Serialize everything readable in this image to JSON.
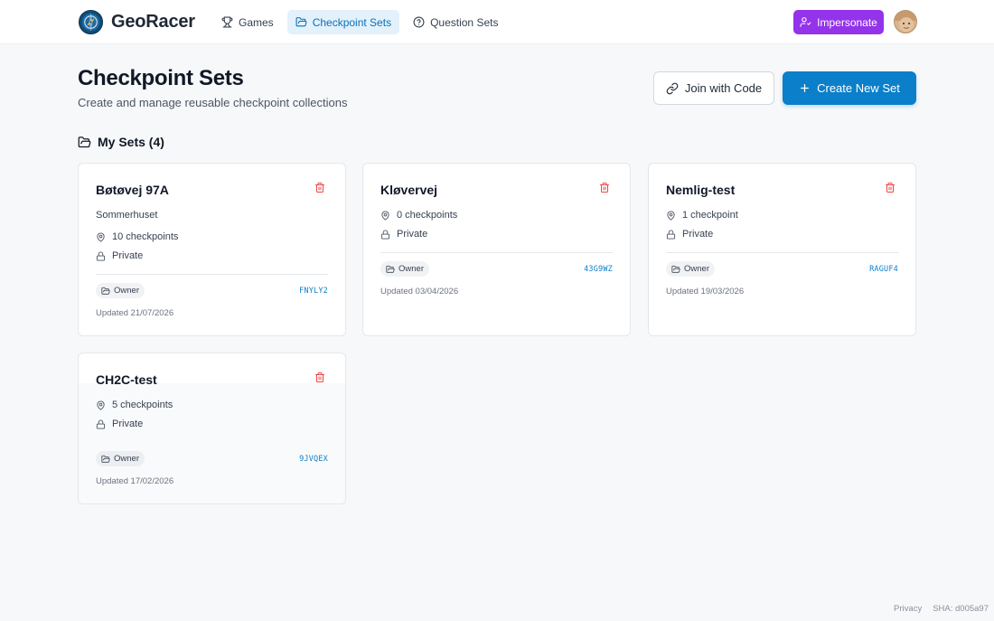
{
  "app": {
    "name": "GeoRacer"
  },
  "nav": {
    "games": "Games",
    "checkpoint_sets": "Checkpoint Sets",
    "question_sets": "Question Sets"
  },
  "header": {
    "impersonate": "Impersonate"
  },
  "page": {
    "title": "Checkpoint Sets",
    "subtitle": "Create and manage reusable checkpoint collections",
    "join_label": "Join with Code",
    "create_label": "Create New Set",
    "section_title": "My Sets (4)"
  },
  "cards": [
    {
      "name": "Bøtøvej 97A",
      "description": "Sommerhuset",
      "checkpoints": "10 checkpoints",
      "visibility": "Private",
      "role": "Owner",
      "code": "FNYLY2",
      "updated": "Updated 21/07/2026"
    },
    {
      "name": "Kløvervej",
      "checkpoints": "0 checkpoints",
      "visibility": "Private",
      "role": "Owner",
      "code": "43G9WZ",
      "updated": "Updated 03/04/2026"
    },
    {
      "name": "Nemlig-test",
      "checkpoints": "1 checkpoint",
      "visibility": "Private",
      "role": "Owner",
      "code": "RAGUF4",
      "updated": "Updated 19/03/2026"
    },
    {
      "name": "CH2C-test",
      "checkpoints": "5 checkpoints",
      "visibility": "Private",
      "role": "Owner",
      "code": "9JVQEX",
      "updated": "Updated 17/02/2026"
    }
  ],
  "footer": {
    "privacy": "Privacy",
    "sha": "SHA: d005a97"
  },
  "colors": {
    "primary": "#0b7fc9",
    "impersonate": "#9333ea",
    "danger": "#ef4444",
    "nav_active_bg": "#e3f1fb"
  }
}
